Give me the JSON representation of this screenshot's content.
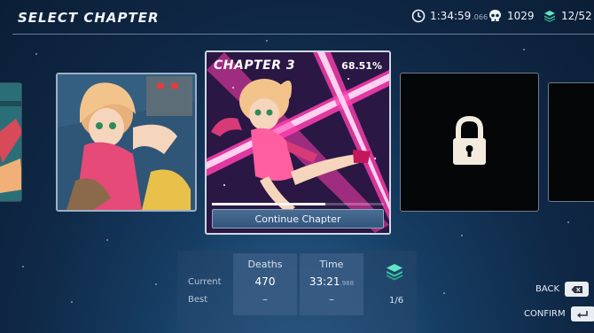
{
  "header": {
    "title": "SELECT CHAPTER",
    "total_time": "1:34:59",
    "total_time_ms": ".066",
    "deaths": "1029",
    "gems": "12/52"
  },
  "chapters": {
    "current": {
      "title": "CHAPTER 3",
      "completion": "68.51%",
      "progress_fraction": 0.66,
      "button_label": "Continue Chapter"
    },
    "next_locked": true
  },
  "stats": {
    "row_current": "Current",
    "row_best": "Best",
    "deaths_header": "Deaths",
    "time_header": "Time",
    "deaths_current": "470",
    "deaths_best": "–",
    "time_current": "33:21",
    "time_current_ms": ".988",
    "time_best": "–",
    "gems": "1/6"
  },
  "controls": {
    "back_label": "BACK",
    "confirm_label": "CONFIRM"
  },
  "colors": {
    "background": "#163d63",
    "accent_pink": "#ff3fb0",
    "panel": "#3c5f87",
    "gem": "#3fcfae"
  },
  "icons": {
    "time": "clock-icon",
    "deaths": "skull-icon",
    "gems": "gem-stack-icon",
    "locked": "padlock-icon",
    "back": "backspace-key-icon",
    "confirm": "enter-key-icon"
  }
}
